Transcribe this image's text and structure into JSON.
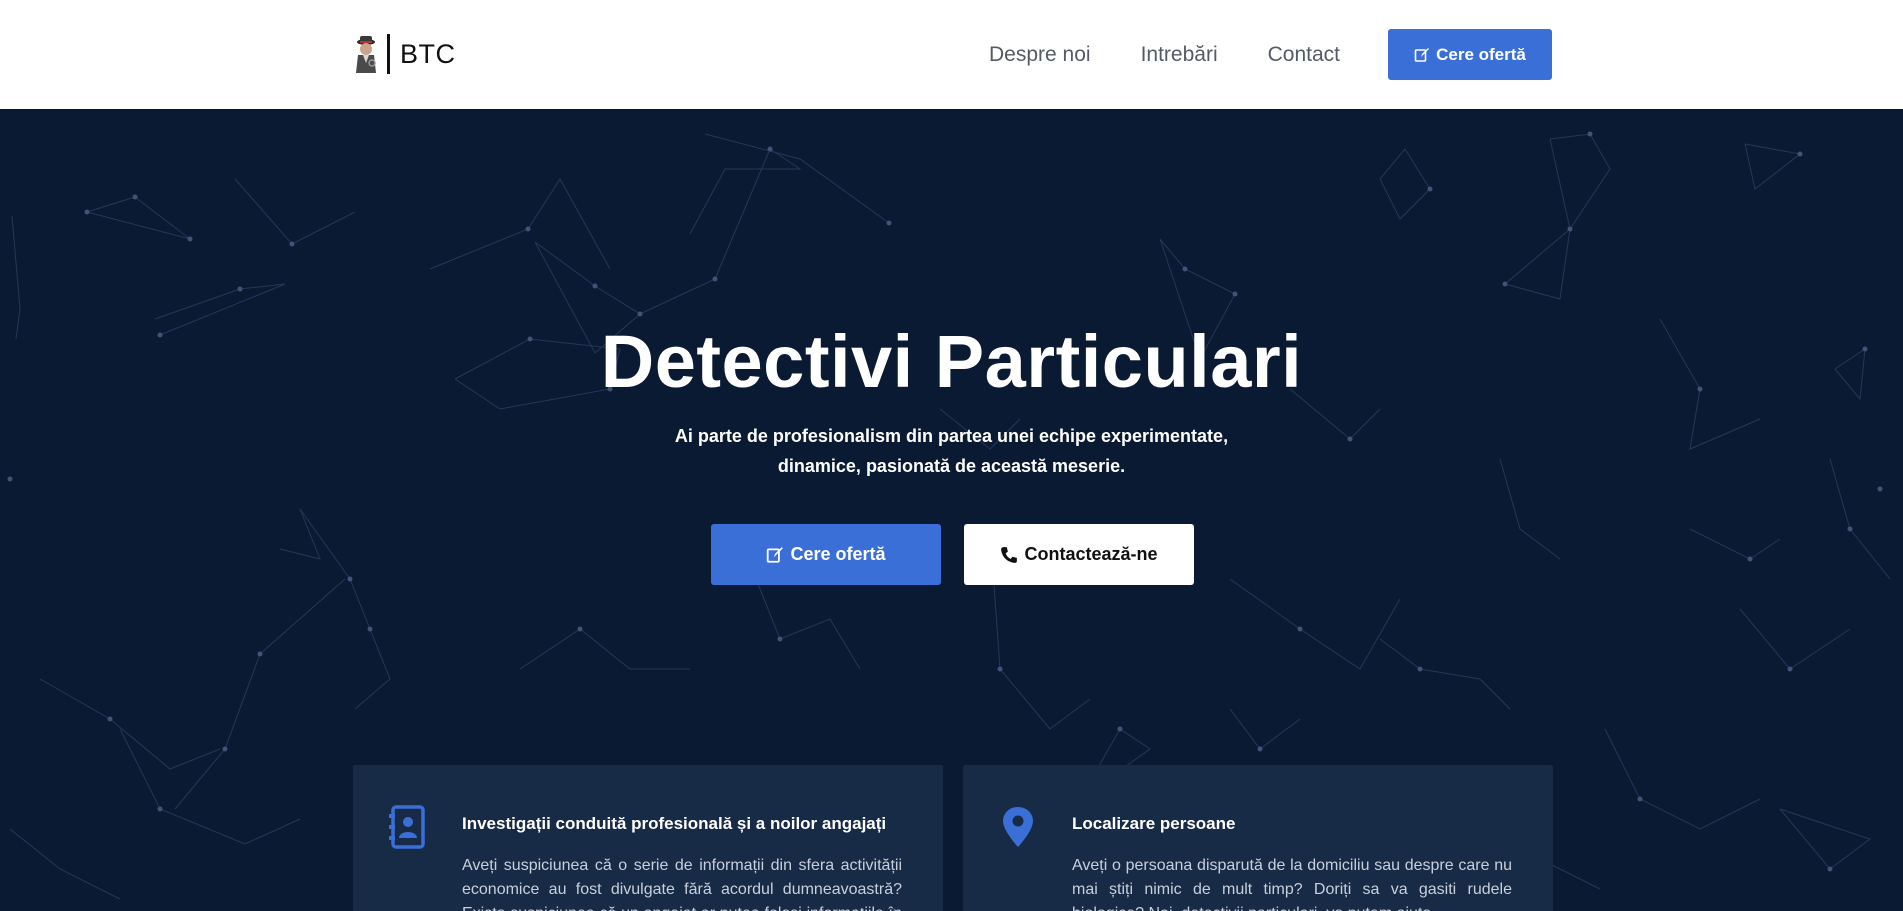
{
  "header": {
    "brand": "BTC",
    "nav": [
      "Despre noi",
      "Intrebări",
      "Contact"
    ],
    "cta_label": "Cere ofertă"
  },
  "hero": {
    "title": "Detectivi Particulari",
    "subtitle_line1": "Ai parte de profesionalism din partea unei echipe experimentate,",
    "subtitle_line2": "dinamice, pasionată de această meserie.",
    "primary_button": "Cere ofertă",
    "secondary_button": "Contactează-ne"
  },
  "services": [
    {
      "icon": "address-book-icon",
      "title": "Investigații conduită profesională și a noilor angajați",
      "text": "Aveți suspiciunea că o serie de informații din sfera activității economice au fost divulgate fără acordul dumneavoastră? Exista suspiciunea că un angajat ar putea folosi informațiile în scop personal?"
    },
    {
      "icon": "map-marker-icon",
      "title": "Localizare persoane",
      "text": "Aveți o persoana disparută de la domiciliu sau despre care nu mai știți nimic de mult timp? Doriți sa va gasiti rudele biologice? Noi, detectivii particulari, va putem ajuta."
    }
  ],
  "colors": {
    "accent": "#3a6fd8",
    "hero_bg": "#0b1a33",
    "card_bg": "#172a46",
    "header_bg": "#ffffff"
  }
}
